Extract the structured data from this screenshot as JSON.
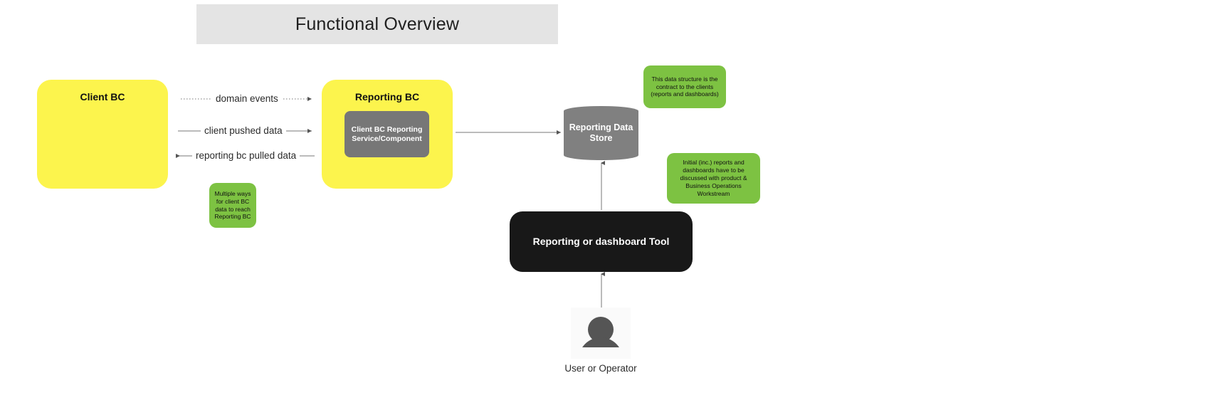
{
  "title": {
    "text": "Functional Overview"
  },
  "nodes": {
    "client_bc": {
      "label": "Client BC",
      "color": "#fcf44d"
    },
    "reporting_bc": {
      "label": "Reporting BC",
      "color": "#fcf44d"
    },
    "reporting_service": {
      "label": "Client BC Reporting Service/Component",
      "color": "#777777"
    },
    "data_store": {
      "label": "Reporting Data Store",
      "color": "#808080"
    },
    "reporting_tool": {
      "label": "Reporting or dashboard Tool",
      "color": "#181818"
    },
    "actor": {
      "label": "User or Operator",
      "icon": "person-icon"
    }
  },
  "edges": [
    {
      "id": "domain-events",
      "label": "domain events",
      "style": "dotted",
      "direction": "client-bc-to-reporting-bc"
    },
    {
      "id": "client-pushed-data",
      "label": "client pushed data",
      "style": "solid",
      "direction": "client-bc-to-reporting-bc"
    },
    {
      "id": "reporting-bc-pulled-data",
      "label": "reporting bc pulled data",
      "style": "solid",
      "direction": "reporting-bc-to-client-bc"
    }
  ],
  "notes": {
    "contract": "This data structure is the contract to the clients (reports and dashboards)",
    "initial": "Initial (inc.) reports and dashboards have to be discussed with product & Business Operations Workstream",
    "multiple_ways": "Multiple ways for client BC data to reach Reporting BC",
    "color": "#7dc242"
  }
}
